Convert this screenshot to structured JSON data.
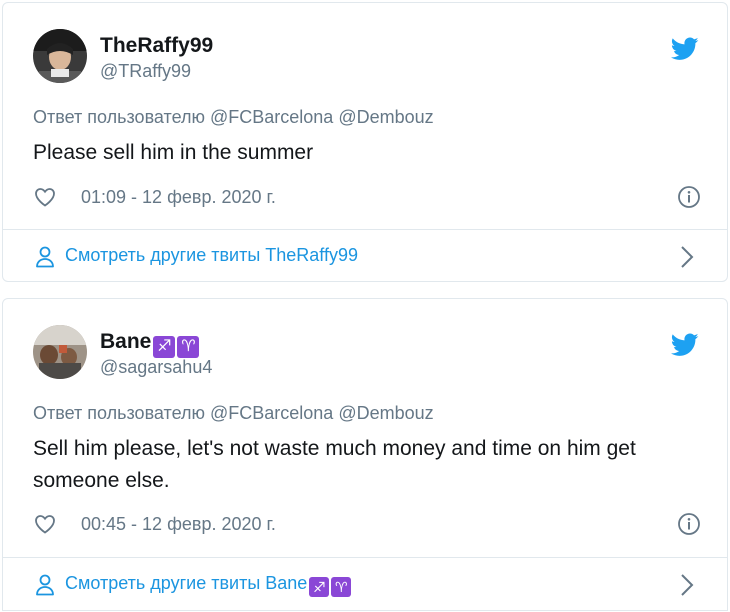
{
  "tweets": [
    {
      "name": "TheRaffy99",
      "name_emoji": [],
      "handle": "@TRaffy99",
      "reply_to": "Ответ пользователю @FCBarcelona @Dembouz",
      "text": "Please sell him in the summer",
      "timestamp": "01:09 - 12 февр. 2020 г.",
      "more_link": "Смотреть другие твиты TheRaffy99",
      "more_link_emoji": [],
      "icons": {
        "avatar": "user-avatar",
        "bird": "twitter-bird-icon",
        "like": "heart-icon",
        "info": "info-icon",
        "person": "person-icon",
        "chevron": "chevron-right-icon"
      }
    },
    {
      "name": "Bane",
      "name_emoji": [
        "♐",
        "♈"
      ],
      "handle": "@sagarsahu4",
      "reply_to": "Ответ пользователю @FCBarcelona @Dembouz",
      "text": "Sell him please, let's not waste much money and time on him get someone else.",
      "timestamp": "00:45 - 12 февр. 2020 г.",
      "more_link": "Смотреть другие твиты Bane",
      "more_link_emoji": [
        "♐",
        "♈"
      ],
      "icons": {
        "avatar": "user-avatar",
        "bird": "twitter-bird-icon",
        "like": "heart-icon",
        "info": "info-icon",
        "person": "person-icon",
        "chevron": "chevron-right-icon"
      }
    }
  ],
  "colors": {
    "twitter_blue": "#1da1f2",
    "link_blue": "#1b95e0",
    "muted": "#657786",
    "text": "#14171a",
    "border": "#e1e8ed",
    "zodiac_purple": "#8a47d6"
  }
}
